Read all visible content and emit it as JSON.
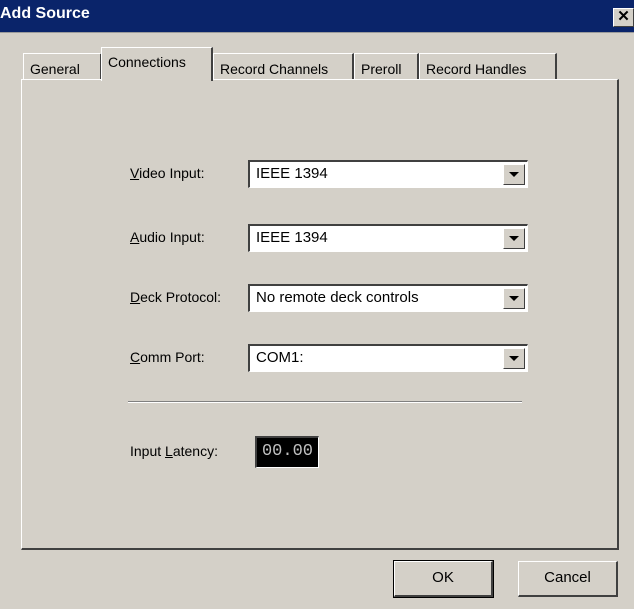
{
  "window": {
    "title": "Add Source",
    "close_glyph": "✕"
  },
  "tabs": [
    {
      "label": "General",
      "active": false
    },
    {
      "label": "Connections",
      "active": true
    },
    {
      "label": "Record Channels",
      "active": false
    },
    {
      "label": "Preroll",
      "active": false
    },
    {
      "label": "Record Handles",
      "active": false
    }
  ],
  "fields": {
    "video_input": {
      "mnemonic": "V",
      "label_rest": "ideo Input:",
      "value": "IEEE 1394"
    },
    "audio_input": {
      "mnemonic": "A",
      "label_rest": "udio Input:",
      "value": "IEEE 1394"
    },
    "deck_protocol": {
      "mnemonic": "D",
      "label_rest": "eck Protocol:",
      "value": "No remote deck controls"
    },
    "comm_port": {
      "mnemonic": "C",
      "label_rest": "omm Port:",
      "value": "COM1:"
    }
  },
  "latency": {
    "label_pre": "Input ",
    "mnemonic": "L",
    "label_rest": "atency:",
    "value": "00.00"
  },
  "buttons": {
    "ok": "OK",
    "cancel": "Cancel"
  },
  "icons": {
    "close": "close-icon",
    "dropdown": "chevron-down-icon"
  }
}
